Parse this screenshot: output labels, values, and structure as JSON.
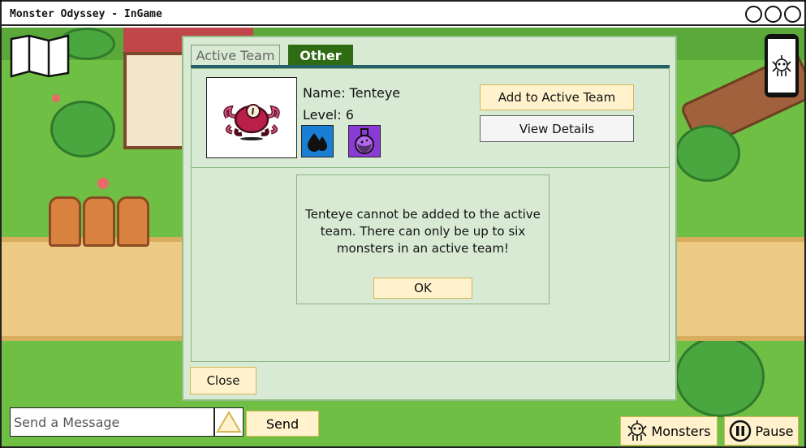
{
  "window": {
    "title": "Monster Odyssey - InGame"
  },
  "tabs": [
    {
      "label": "Active Team",
      "active": false
    },
    {
      "label": "Other",
      "active": true
    }
  ],
  "monster": {
    "name_text": "Name: Tenteye",
    "level_text": "Level: 6",
    "types": [
      "water-icon",
      "poison-icon"
    ]
  },
  "actions": {
    "add_label": "Add to Active Team",
    "view_label": "View Details"
  },
  "alert": {
    "message": "Tenteye cannot be added to the active team. There can only be up to six monsters in an active team!",
    "ok_label": "OK"
  },
  "dialog": {
    "close_label": "Close"
  },
  "chat": {
    "placeholder": "Send a Message",
    "send_label": "Send"
  },
  "hud": {
    "monsters_label": "Monsters",
    "pause_label": "Pause"
  },
  "colors": {
    "dialog_bg": "#d8ead4",
    "tab_active": "#2f6b12",
    "button_yellow": "#fff2cc"
  }
}
